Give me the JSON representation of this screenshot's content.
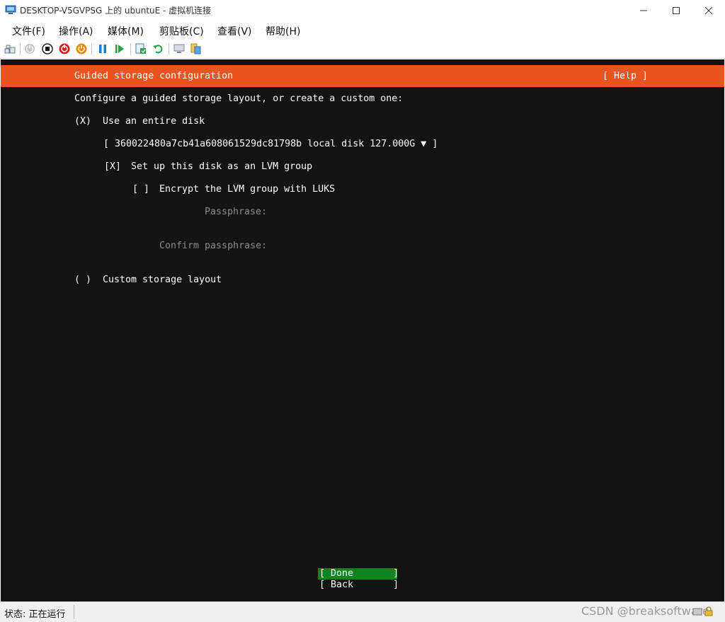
{
  "window": {
    "title": "DESKTOP-V5GVPSG 上的 ubuntuE - 虚拟机连接"
  },
  "menu": {
    "items": [
      "文件(F)",
      "操作(A)",
      "媒体(M)",
      "剪贴板(C)",
      "查看(V)",
      "帮助(H)"
    ]
  },
  "toolbar": {
    "icons": [
      "ctrl-alt-del-icon",
      "start-icon",
      "turn-off-icon",
      "shutdown-icon",
      "save-icon",
      "pause-icon",
      "resume-icon",
      "checkpoint-icon",
      "revert-icon",
      "enhanced-session-icon",
      "share-icon"
    ]
  },
  "installer": {
    "header_title": "Guided storage configuration",
    "help_label": "[ Help ]",
    "intro": "Configure a guided storage layout, or create a custom one:",
    "entire_disk_marker": "(X)",
    "entire_disk_label": "Use an entire disk",
    "disk_select": "[ 360022480a7cb41a608061529dc81798b local disk 127.000G ▼ ]",
    "lvm_marker": "[X]",
    "lvm_label": "Set up this disk as an LVM group",
    "encrypt_marker": "[ ]",
    "encrypt_label": "Encrypt the LVM group with LUKS",
    "passphrase_label": "Passphrase:",
    "confirm_passphrase_label": "Confirm passphrase:",
    "custom_marker": "( )",
    "custom_label": "Custom storage layout",
    "done_button": "[ Done       ]",
    "back_button": "[ Back       ]"
  },
  "statusbar": {
    "status": "状态: 正在运行",
    "watermark": "CSDN @breaksoftware"
  },
  "colors": {
    "accent": "#e95420",
    "console_bg": "#131313",
    "done_highlight": "#0e8420",
    "disabled_text": "#8c8c8c"
  }
}
